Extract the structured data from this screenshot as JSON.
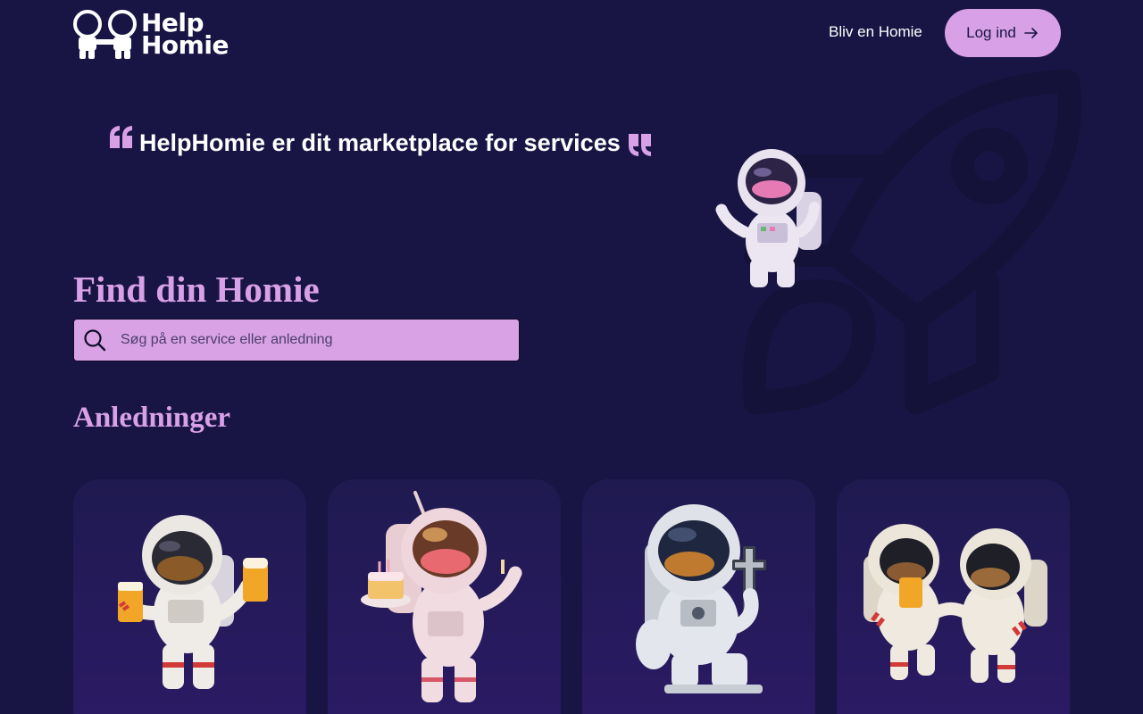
{
  "header": {
    "logo_line1": "Help",
    "logo_line2": "Homie",
    "nav_become": "Bliv en Homie",
    "login_label": "Log ind"
  },
  "hero": {
    "quote": "HelpHomie er dit marketplace for services"
  },
  "search": {
    "title": "Find din Homie",
    "placeholder": "Søg på en service eller anledning",
    "value": ""
  },
  "occasions": {
    "title": "Anledninger",
    "cards": [
      {
        "icon": "astronaut-beer-icon"
      },
      {
        "icon": "astronaut-birthday-icon"
      },
      {
        "icon": "astronaut-funeral-icon"
      },
      {
        "icon": "astronaut-party-icon"
      }
    ]
  },
  "colors": {
    "background": "#181544",
    "accent": "#d8a0e6",
    "text": "#ffffff"
  }
}
